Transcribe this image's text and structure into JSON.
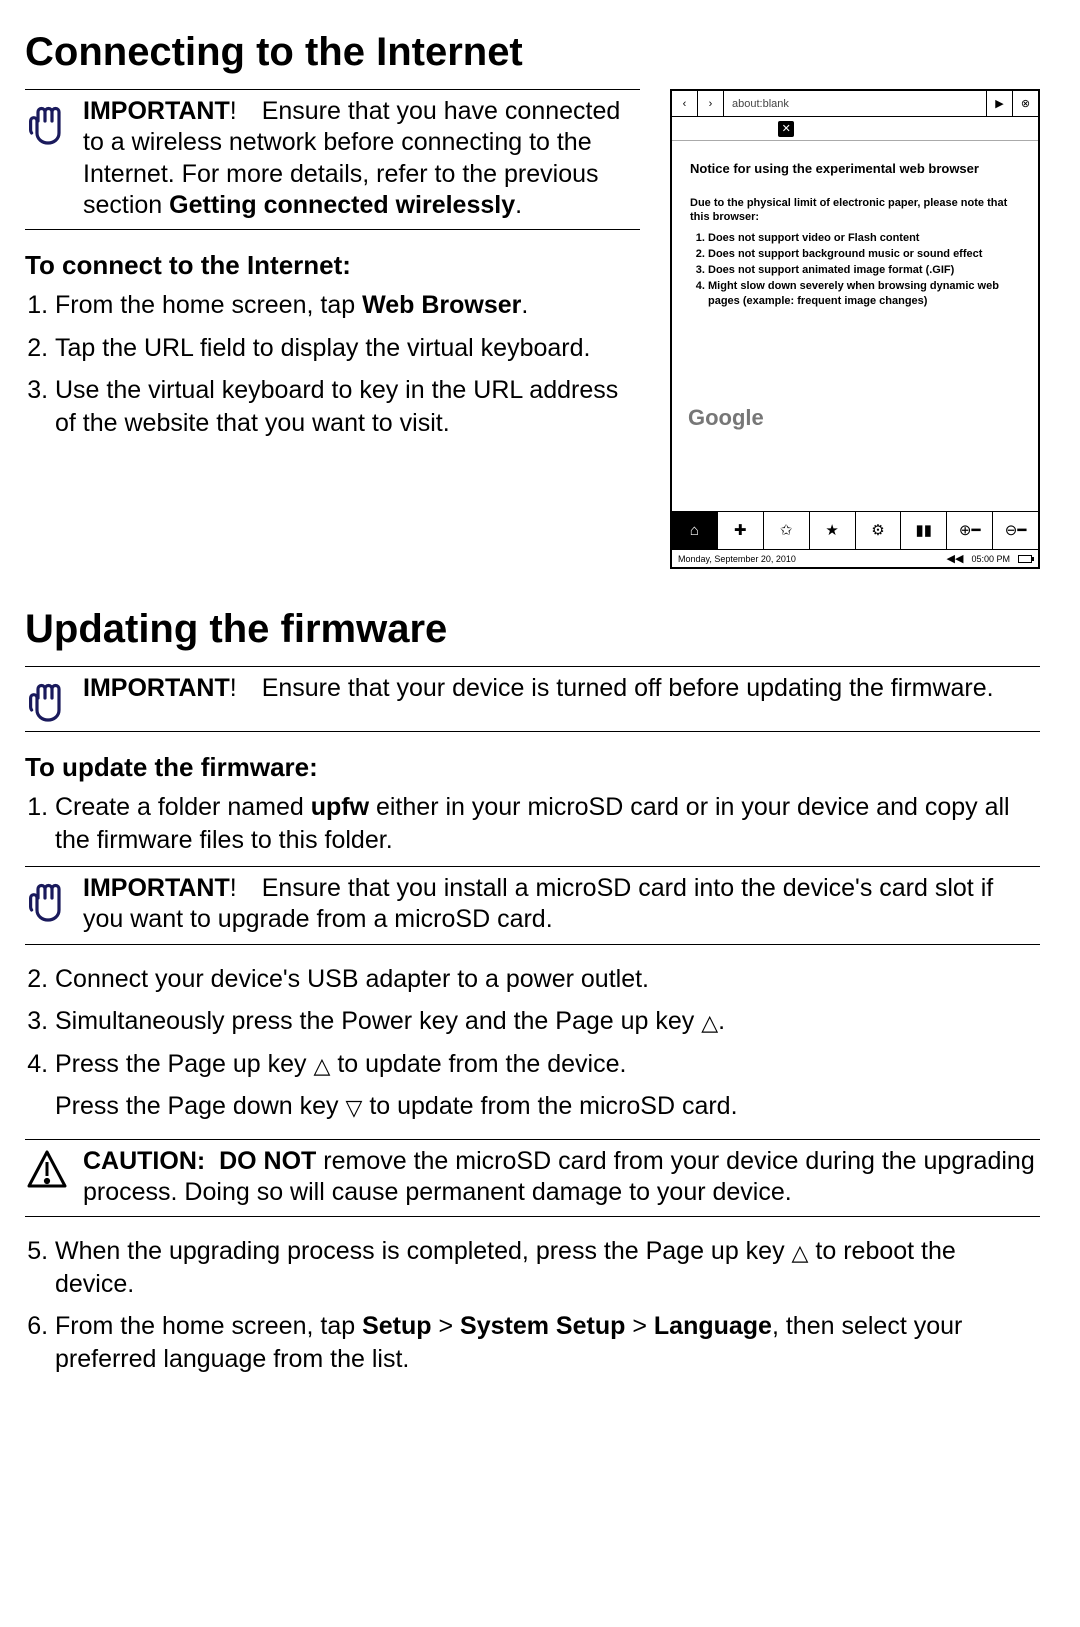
{
  "sections": {
    "connect": {
      "heading": "Connecting to the Internet",
      "important_lead": "IMPORTANT",
      "important_text": "! Ensure that you have connected to a wireless network before connecting to the Internet. For more details, refer to the previous section ",
      "important_ref": "Getting connected wirelessly",
      "subhead": "To connect to the Internet:",
      "steps": [
        {
          "pre": "From the home screen, tap ",
          "bold": "Web Browser",
          "post": "."
        },
        {
          "pre": "Tap the URL field to display the virtual keyboard.",
          "bold": "",
          "post": ""
        },
        {
          "pre": "Use the virtual keyboard to key in the URL address of the website that you want to visit.",
          "bold": "",
          "post": ""
        }
      ]
    },
    "firmware": {
      "heading": "Updating the firmware",
      "important1_lead": "IMPORTANT",
      "important1_text": "! Ensure that your device is turned off before updating the firmware.",
      "subhead": "To update the firmware:",
      "step1_pre": "Create a folder named ",
      "step1_bold": "upfw",
      "step1_post": " either in your microSD card or in your device and copy all the firmware files to this folder.",
      "important2_lead": "IMPORTANT",
      "important2_text": "! Ensure that you install a microSD card into the device's card slot if you want to upgrade from a microSD card.",
      "step2": "Connect your device's USB adapter to a power outlet.",
      "step3_pre": "Simultaneously press the Power key and the Page up key ",
      "step3_post": ".",
      "step4_pre": "Press the Page up key ",
      "step4_post": " to update from the device.",
      "step4b_pre": "Press the Page down key ",
      "step4b_post": " to update from the microSD card.",
      "caution_lead": "CAUTION:  DO NOT",
      "caution_text": " remove the microSD card from your device during the upgrading process. Doing so will cause permanent damage to your device.",
      "step5_pre": "When the upgrading process is completed, press the Page up key ",
      "step5_post": " to reboot the device.",
      "step6_pre": "From the home screen, tap ",
      "step6_b1": "Setup",
      "step6_gt1": " > ",
      "step6_b2": "System Setup",
      "step6_gt2": " > ",
      "step6_b3": "Language",
      "step6_post": ", then select your preferred language from the list."
    }
  },
  "screenshot": {
    "url": "about:blank",
    "notice_title": "Notice for using the experimental web browser",
    "notice_pre": "Due to the physical limit of electronic paper, please note that this browser:",
    "notice_items": [
      "Does not support video or Flash content",
      "Does not support background music or sound effect",
      "Does not support animated image format (.GIF)",
      "Might slow down severely when browsing dynamic web pages (example: frequent image changes)"
    ],
    "logo": "Google",
    "date": "Monday, September 20, 2010",
    "time": "05:00 PM"
  }
}
